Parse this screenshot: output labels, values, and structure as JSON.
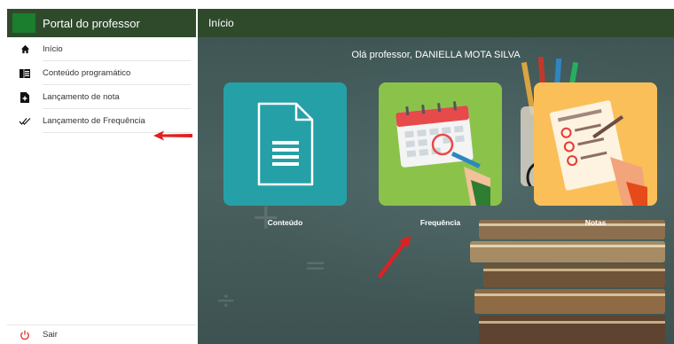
{
  "sidebar": {
    "title": "Portal do professor",
    "items": [
      {
        "label": "Início",
        "icon": "home-icon"
      },
      {
        "label": "Conteúdo programático",
        "icon": "book-icon"
      },
      {
        "label": "Lançamento de nota",
        "icon": "file-add-icon"
      },
      {
        "label": "Lançamento de Frequência",
        "icon": "double-check-icon"
      }
    ],
    "logout_label": "Sair",
    "colors": {
      "header_bg": "#2e4a2b",
      "logo": "#1b7d2e",
      "logout_icon": "#e53935"
    }
  },
  "main": {
    "title": "Início",
    "greeting": "Olá professor, DANIELLA MOTA SILVA",
    "tiles": [
      {
        "label": "Conteúdo",
        "icon": "document-icon",
        "color": "#26a0a7"
      },
      {
        "label": "Frequência",
        "icon": "calendar-icon",
        "color": "#8bc34a"
      },
      {
        "label": "Notas",
        "icon": "checklist-icon",
        "color": "#fbbf5a"
      }
    ]
  },
  "annotations": {
    "arrow_color": "#e02020"
  }
}
